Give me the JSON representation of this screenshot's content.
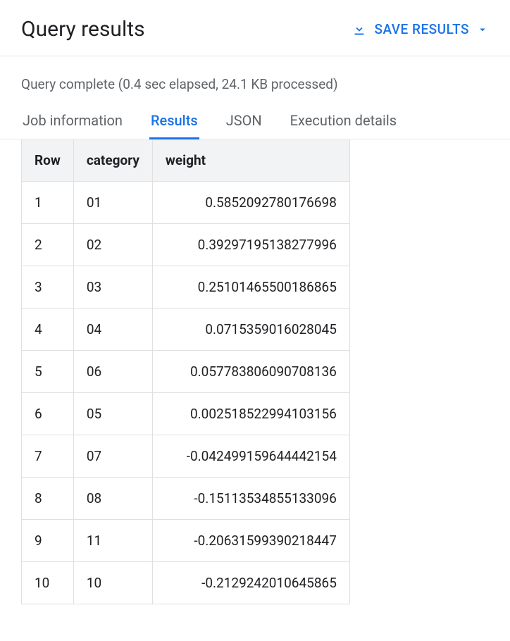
{
  "header": {
    "title": "Query results",
    "save_button": "SAVE RESULTS"
  },
  "status": {
    "text": "Query complete (0.4 sec elapsed, 24.1 KB processed)"
  },
  "tabs": [
    {
      "label": "Job information"
    },
    {
      "label": "Results"
    },
    {
      "label": "JSON"
    },
    {
      "label": "Execution details"
    }
  ],
  "active_tab_index": 1,
  "table": {
    "columns": [
      "Row",
      "category",
      "weight"
    ],
    "rows": [
      {
        "row": "1",
        "category": "01",
        "weight": "0.5852092780176698"
      },
      {
        "row": "2",
        "category": "02",
        "weight": "0.39297195138277996"
      },
      {
        "row": "3",
        "category": "03",
        "weight": "0.25101465500186865"
      },
      {
        "row": "4",
        "category": "04",
        "weight": "0.0715359016028045"
      },
      {
        "row": "5",
        "category": "06",
        "weight": "0.057783806090708136"
      },
      {
        "row": "6",
        "category": "05",
        "weight": "0.002518522994103156"
      },
      {
        "row": "7",
        "category": "07",
        "weight": "-0.042499159644442154"
      },
      {
        "row": "8",
        "category": "08",
        "weight": "-0.15113534855133096"
      },
      {
        "row": "9",
        "category": "11",
        "weight": "-0.20631599390218447"
      },
      {
        "row": "10",
        "category": "10",
        "weight": "-0.2129242010645865"
      }
    ]
  },
  "icons": {
    "download": "download-icon",
    "dropdown": "chevron-down-icon"
  }
}
